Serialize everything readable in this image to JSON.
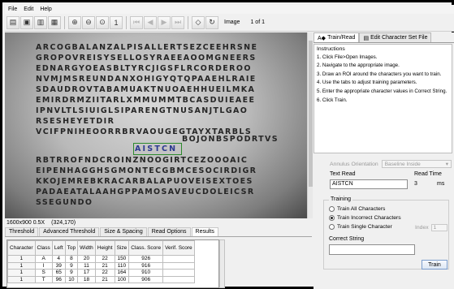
{
  "menu": [
    "File",
    "Edit",
    "Help"
  ],
  "toolbar": {
    "image_label": "Image",
    "image_position": "1 of 1"
  },
  "image_text_lines": [
    "ARCOGBALANZALPISALLERTSEZCEEHRSNE",
    "GROPOVREISYSELLOSYRAEEAOOMGNEERS",
    "EDNARGYOEASBLTYRCJIGSFLRCORDEROO",
    "NVMJMSREUNDANXOHIGYQTQPAAEHLRAIE",
    "SDAUDROVTABAMUAKTNUOAEHHUEILMKA",
    "EMIRDRMZIITARLXMMUMMTBCASDUIEAEE",
    "IPNVLTLSIUIGLSIPARENGTNUSANJTLGAO",
    "RSESHEYETDIR",
    "VCIFPNIHEOORRBRVAOUGEGTAYXTARBLS",
    "CLEDIDLOROHMERIDRONZNOOGIRTCEZOOAIC",
    "RBTRROFNDCROINZNOOGIRTCEZOOOAIC",
    "EIPENHAGGHSGMONTECGBMCESOCIRDIGR",
    "KKOJEMREBKRACARBALAPUOVEISEXTOES",
    "PADAEATALAAHGPPAMOSAVEUCDOLEICSR",
    "SSEGUNDO"
  ],
  "roi_text": "AISTCN",
  "roi_line_tail": "BOJONBSPODRTVS",
  "status": {
    "size": "1600x900 0.5X",
    "coords": "(324,170)"
  },
  "bottom_tabs": [
    "Threshold",
    "Advanced Threshold",
    "Size & Spacing",
    "Read Options",
    "Results"
  ],
  "results": {
    "columns": [
      "Character",
      "Class",
      "Left",
      "Top",
      "Width",
      "Height",
      "Size",
      "Class. Score",
      "Verif. Score"
    ],
    "rows": [
      [
        "1",
        "A",
        "4",
        "8",
        "20",
        "22",
        "150",
        "926",
        ""
      ],
      [
        "1",
        "I",
        "39",
        "9",
        "11",
        "21",
        "110",
        "916",
        ""
      ],
      [
        "1",
        "S",
        "65",
        "9",
        "17",
        "22",
        "164",
        "910",
        ""
      ],
      [
        "1",
        "T",
        "96",
        "10",
        "18",
        "21",
        "100",
        "906",
        ""
      ]
    ]
  },
  "right_tabs": {
    "train_read": "Train/Read",
    "edit_charset": "Edit Character Set File"
  },
  "instructions": {
    "heading": "Instructions",
    "steps": [
      "1. Click File>Open Images.",
      "2. Navigate to the appropriate image.",
      "3. Draw an ROI around the characters you want to train.",
      "4. Use the tabs to adjust training parameters.",
      "5. Enter the appropriate character values in Correct String.",
      "6. Click Train."
    ]
  },
  "annulus": {
    "label": "Annulus Orientation",
    "value": "Baseline Inside"
  },
  "text_read": {
    "label": "Text Read",
    "value": "AISTCN"
  },
  "read_time": {
    "label": "Read Time",
    "value": "3",
    "unit": "ms"
  },
  "training": {
    "legend": "Training",
    "options": [
      "Train All Characters",
      "Train Incorrect Characters",
      "Train Single Character"
    ],
    "selected": "Train Incorrect Characters",
    "index_label": "Index",
    "index_value": "1"
  },
  "correct_string": {
    "label": "Correct String",
    "value": ""
  },
  "train_button": "Train"
}
